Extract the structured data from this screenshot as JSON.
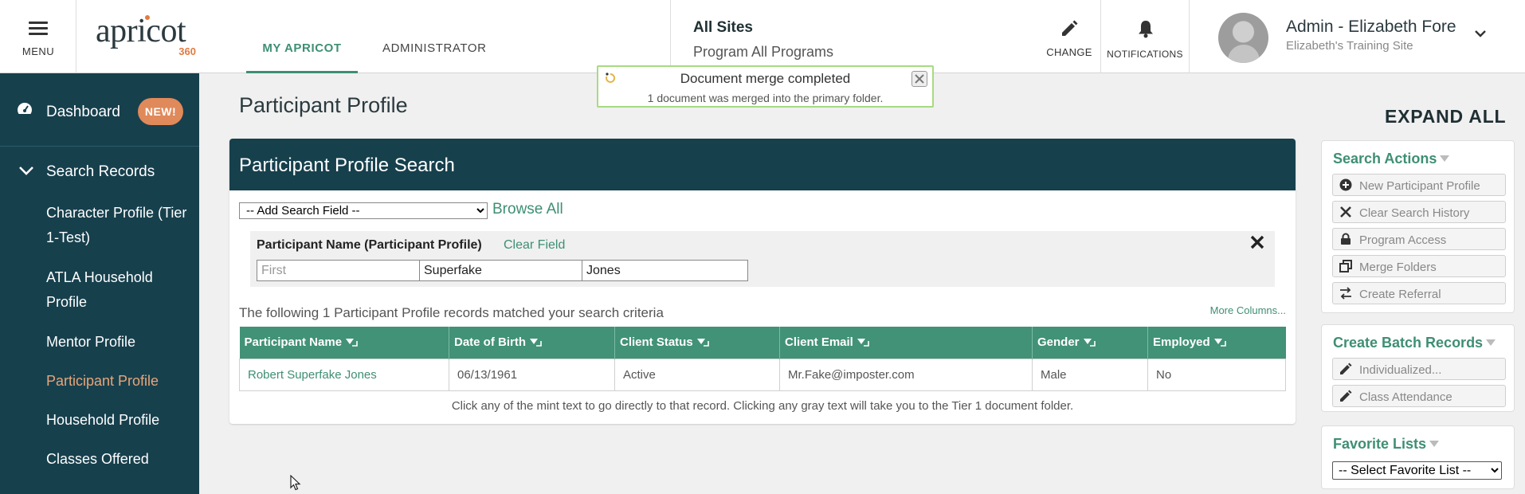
{
  "header": {
    "menu_label": "MENU",
    "logo_text": "apricot",
    "logo_sub": "360",
    "tabs": [
      {
        "label": "MY APRICOT",
        "active": true
      },
      {
        "label": "ADMINISTRATOR",
        "active": false
      }
    ],
    "site": {
      "title": "All Sites",
      "program": "Program All Programs"
    },
    "change_label": "CHANGE",
    "notifications_label": "NOTIFICATIONS",
    "user": {
      "name": "Admin - Elizabeth Fore",
      "site": "Elizabeth's Training Site"
    }
  },
  "toast": {
    "title": "Document merge completed",
    "message": "1 document was merged into the primary folder."
  },
  "sidebar": {
    "dashboard_label": "Dashboard",
    "dashboard_badge": "NEW!",
    "search_label": "Search Records",
    "items": [
      {
        "label": "Character Profile (Tier 1-Test)",
        "current": false
      },
      {
        "label": "ATLA Household Profile",
        "current": false
      },
      {
        "label": "Mentor Profile",
        "current": false
      },
      {
        "label": "Participant Profile",
        "current": true
      },
      {
        "label": "Household Profile",
        "current": false
      },
      {
        "label": "Classes Offered",
        "current": false
      }
    ]
  },
  "main": {
    "page_title": "Participant Profile",
    "panel_title": "Participant Profile Search",
    "add_field_selected": "-- Add Search Field --",
    "browse_all": "Browse All",
    "field": {
      "label": "Participant Name (Participant Profile)",
      "clear": "Clear Field",
      "first_placeholder": "First",
      "first_value": "",
      "middle_value": "Superfake",
      "last_value": "Jones"
    },
    "match_message": "The following 1 Participant Profile records matched your search criteria",
    "more_columns": "More Columns...",
    "table": {
      "columns": [
        "Participant Name",
        "Date of Birth",
        "Client Status",
        "Client Email",
        "Gender",
        "Employed"
      ],
      "rows": [
        [
          "Robert Superfake Jones",
          "06/13/1961",
          "Active",
          "Mr.Fake@imposter.com",
          "Male",
          "No"
        ]
      ]
    },
    "footnote": "Click any of the mint text to go directly to that record. Clicking any gray text will take you to the Tier 1 document folder."
  },
  "right": {
    "expand_all": "EXPAND ALL",
    "search_actions": {
      "title": "Search Actions",
      "items": [
        "New Participant Profile",
        "Clear Search History",
        "Program Access",
        "Merge Folders",
        "Create Referral"
      ]
    },
    "batch": {
      "title": "Create Batch Records",
      "items": [
        "Individualized...",
        "Class Attendance"
      ]
    },
    "favorites": {
      "title": "Favorite Lists",
      "selected": "-- Select Favorite List --"
    }
  },
  "colors": {
    "sidebar_bg": "#17404d",
    "accent_mint": "#3e8f73",
    "table_header": "#419276",
    "badge_orange": "#e0895a",
    "current_item": "#e8a579"
  }
}
